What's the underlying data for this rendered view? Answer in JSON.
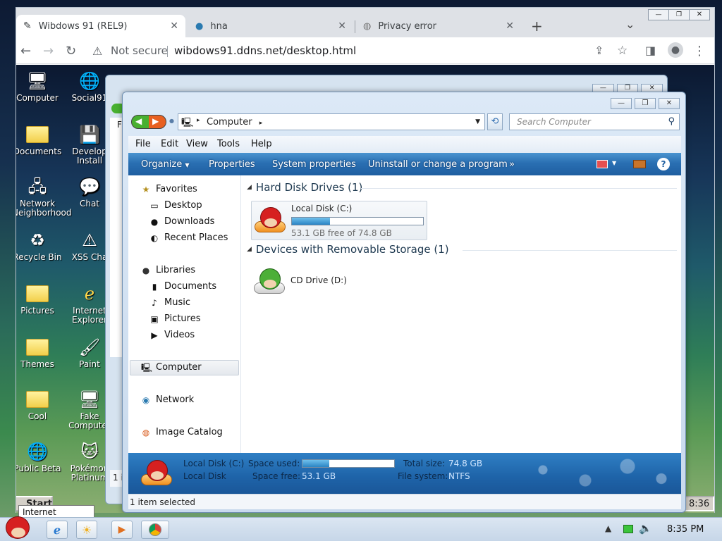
{
  "browser": {
    "tabs": [
      {
        "title": "Wibdows 91 (REL9)",
        "icon": "site-icon",
        "active": true
      },
      {
        "title": "hna",
        "icon": "globe-icon",
        "active": false
      },
      {
        "title": "Privacy error",
        "icon": "warning-globe-icon",
        "active": false
      }
    ],
    "new_tab": "+",
    "tab_search": "⌄",
    "security_label": "Not secure",
    "url": "wibdows91.ddns.net/desktop.html",
    "window_controls": {
      "minimize": "—",
      "restore": "❐",
      "close": "✕"
    }
  },
  "desktop": {
    "icons": [
      {
        "label": "Computer",
        "icon": "computer-icon"
      },
      {
        "label": "Social91",
        "icon": "globe-shortcut-icon"
      },
      {
        "label": "Documents",
        "icon": "documents-icon"
      },
      {
        "label": "Develop Install",
        "icon": "install-icon"
      },
      {
        "label": "Network Neighborhood",
        "icon": "network-icon"
      },
      {
        "label": "Chat",
        "icon": "chat-icon"
      },
      {
        "label": "Recycle Bin",
        "icon": "recycle-bin-icon"
      },
      {
        "label": "XSS Cha",
        "icon": "warning-icon"
      },
      {
        "label": "Pictures",
        "icon": "folder-icon"
      },
      {
        "label": "Internet Explorer",
        "icon": "ie-icon"
      },
      {
        "label": "Themes",
        "icon": "folder-icon"
      },
      {
        "label": "Paint",
        "icon": "paint-icon"
      },
      {
        "label": "Cool",
        "icon": "folder-icon"
      },
      {
        "label": "Fake Computer",
        "icon": "computer-shortcut-icon"
      },
      {
        "label": "Public Beta",
        "icon": "globe-shortcut-icon"
      },
      {
        "label": "Pokémon Platinum",
        "icon": "pokemon-icon"
      }
    ],
    "start_label": "Start",
    "clock_partial": "8:36",
    "back_window_fragments": {
      "left_letter": "F",
      "bottom_fragment": "1 i"
    }
  },
  "explorer": {
    "caption_buttons": {
      "minimize": "—",
      "restore": "❐",
      "close": "✕"
    },
    "breadcrumb": [
      "Computer"
    ],
    "search_placeholder": "Search Computer",
    "menu": [
      "File",
      "Edit",
      "View",
      "Tools",
      "Help"
    ],
    "commands": [
      "Organize",
      "Properties",
      "System properties",
      "Uninstall or change a program",
      "»"
    ],
    "nav": {
      "favorites": "Favorites",
      "favorites_items": [
        "Desktop",
        "Downloads",
        "Recent Places"
      ],
      "libraries": "Libraries",
      "libraries_items": [
        "Documents",
        "Music",
        "Pictures",
        "Videos"
      ],
      "computer": "Computer",
      "network": "Network",
      "image_catalog": "Image Catalog"
    },
    "groups": {
      "hdd": "Hard Disk Drives (1)",
      "removable": "Devices with Removable Storage (1)"
    },
    "drive_c": {
      "name": "Local Disk (C:)",
      "free_text": "53.1 GB free of 74.8 GB",
      "used_fraction": 0.29
    },
    "drive_d": {
      "name": "CD Drive (D:)"
    },
    "details": {
      "name": "Local Disk (C:)",
      "type": "Local Disk",
      "space_used_label": "Space used:",
      "space_free_label": "Space free:",
      "space_free": "53.1 GB",
      "total_size_label": "Total size:",
      "total_size": "74.8 GB",
      "fs_label": "File system:",
      "fs": "NTFS"
    },
    "status": "1 item selected"
  },
  "tooltip": "Internet Explorer",
  "host_taskbar": {
    "clock": "8:35 PM"
  }
}
